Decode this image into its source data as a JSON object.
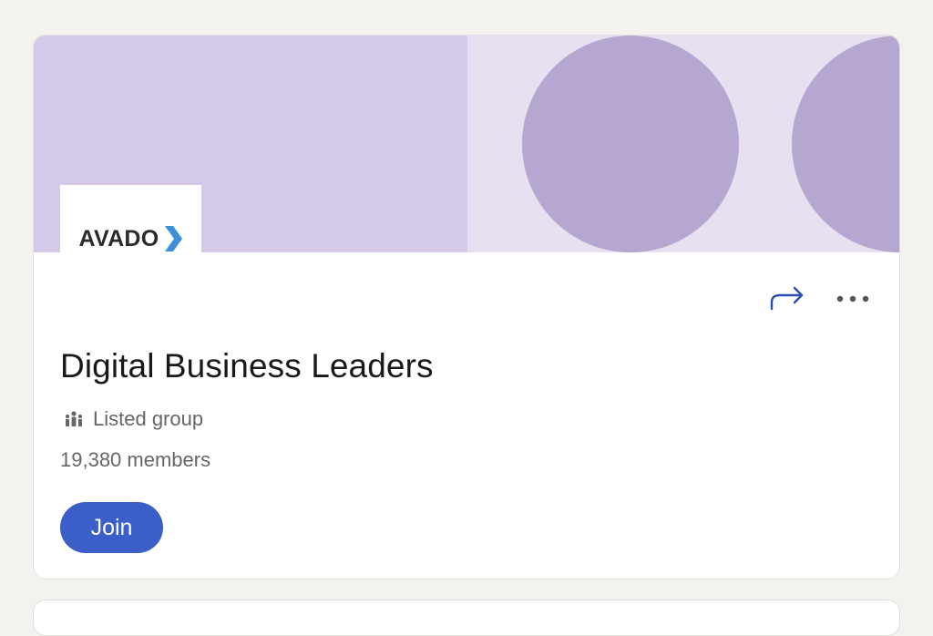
{
  "group": {
    "name": "Digital Business Leaders",
    "visibility": "Listed group",
    "members": "19,380 members",
    "logo_text": "AVADO"
  },
  "actions": {
    "join_label": "Join"
  },
  "icons": {
    "share": "share-arrow-icon",
    "more": "more-dots-icon",
    "visibility": "group-people-icon",
    "logo_mark": "chevron-right-icon"
  },
  "colors": {
    "primary": "#3b5ec9",
    "banner_left": "#d4c9e9",
    "banner_right": "#e6e0f1",
    "banner_circle": "#b5a7cf",
    "logo_chevron": "#3e8ed8",
    "page_bg": "#f4f2ee"
  }
}
